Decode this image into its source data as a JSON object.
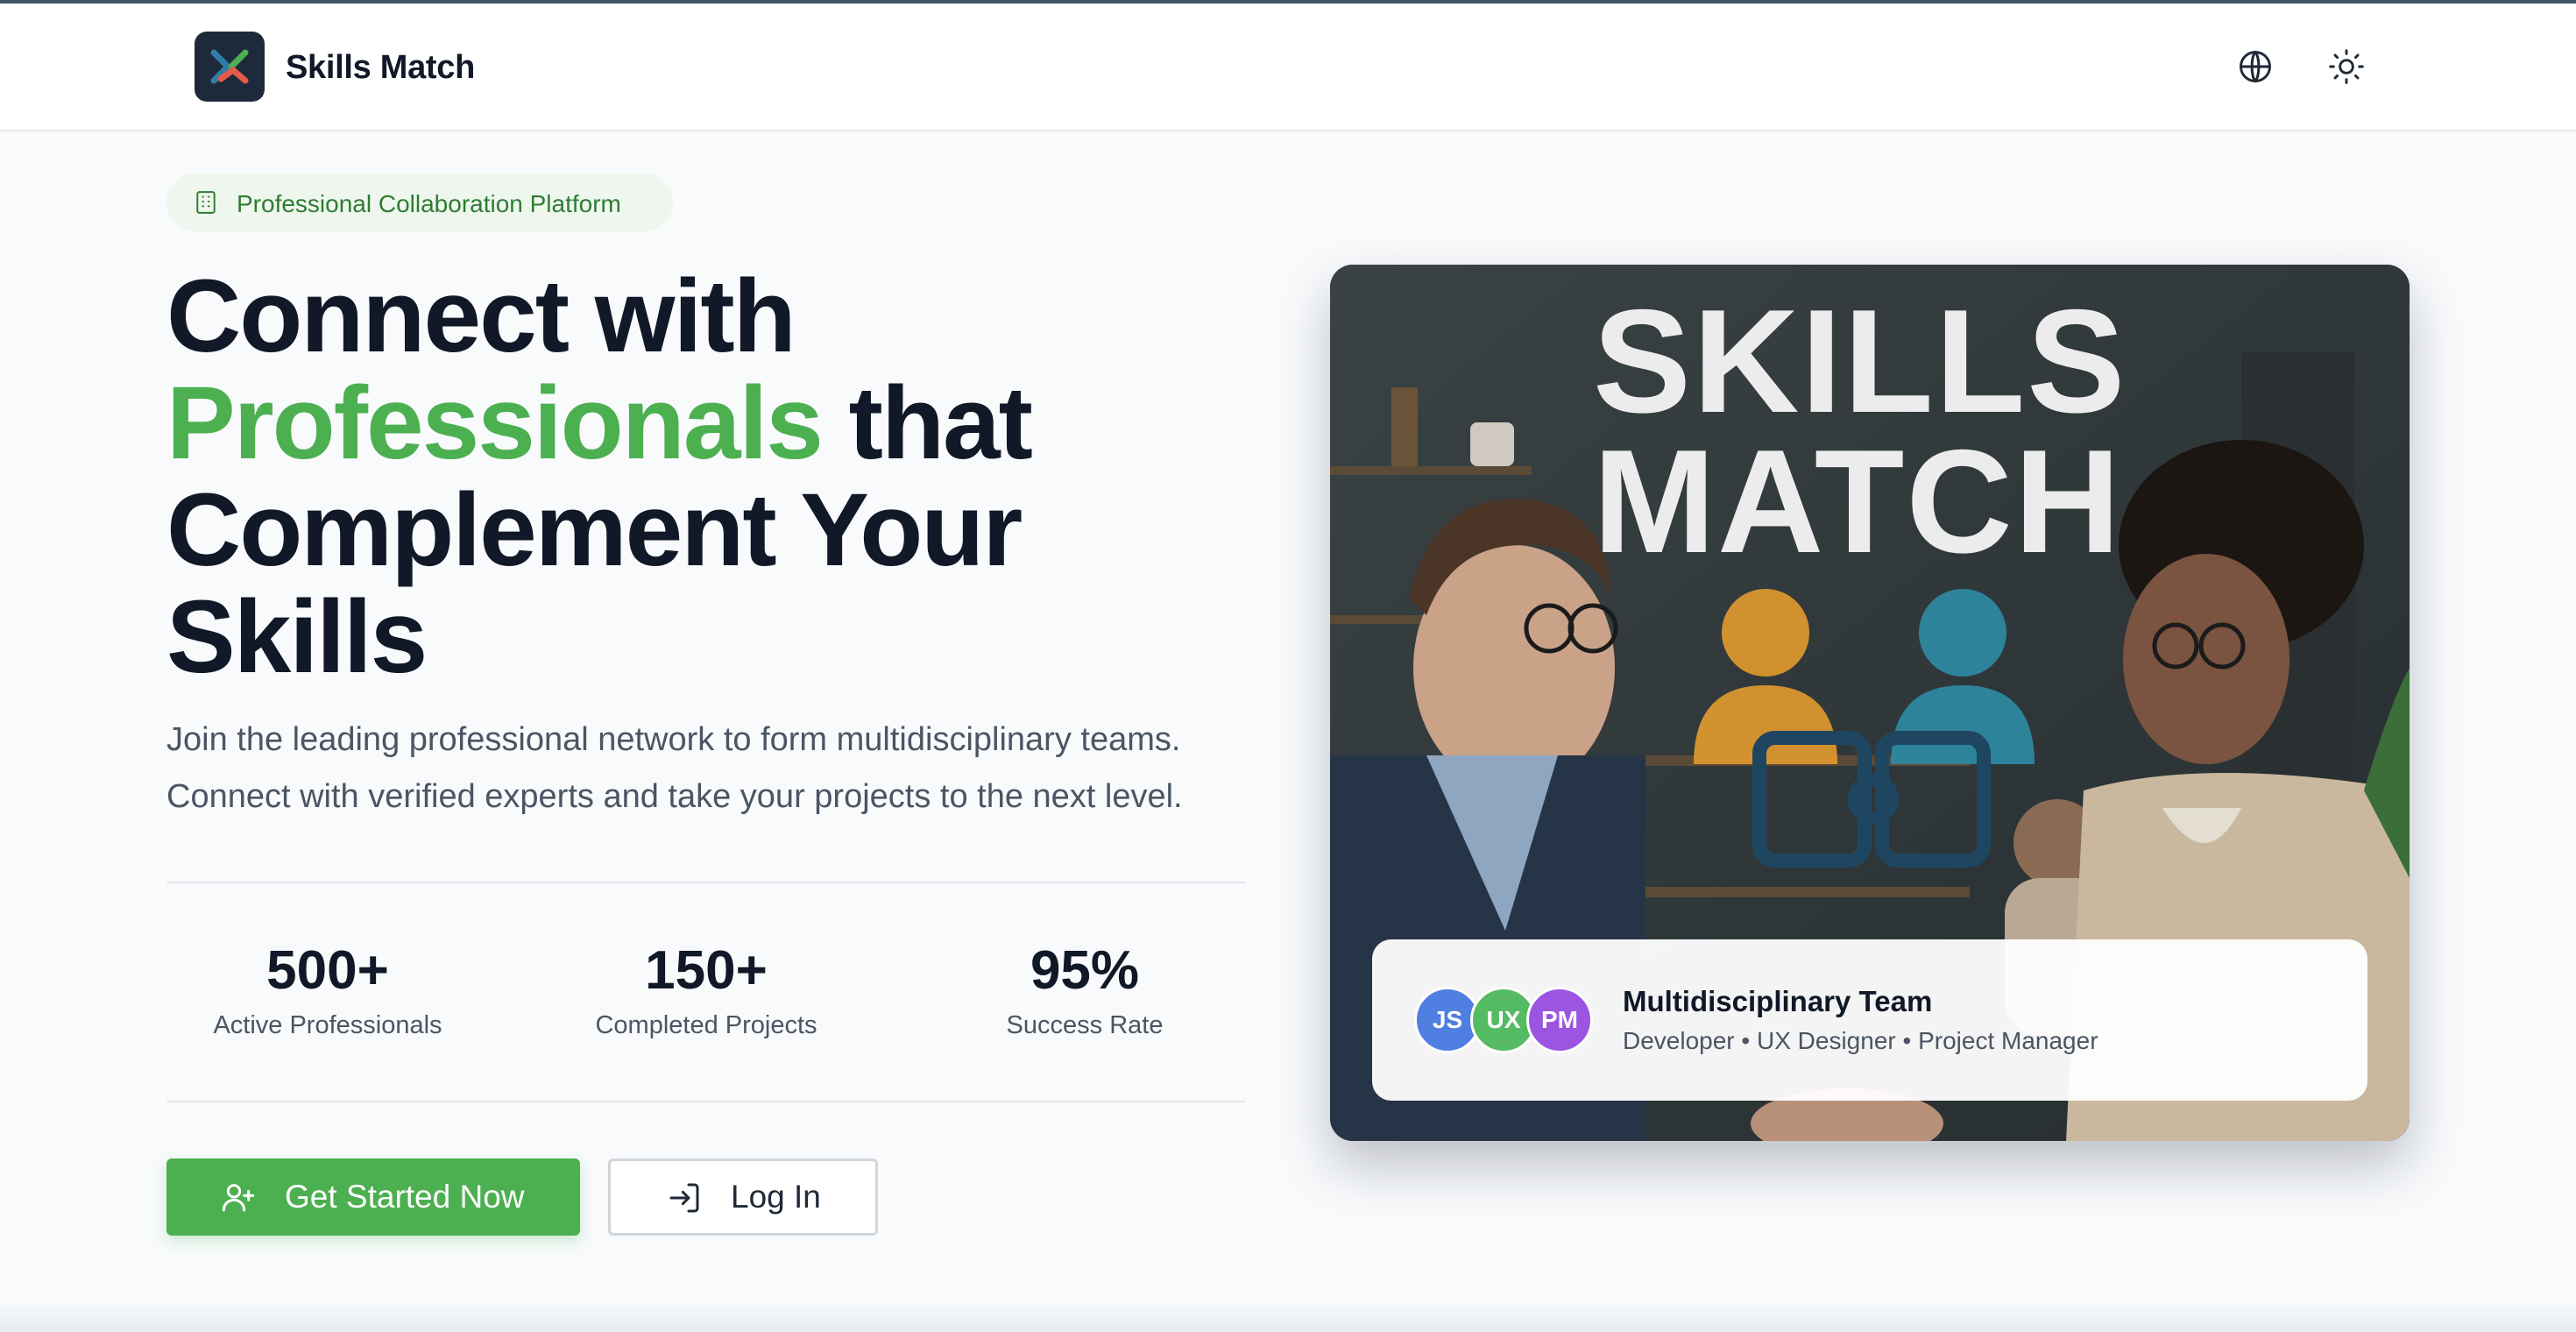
{
  "header": {
    "brand": "Skills Match",
    "icons": [
      "logo-icon",
      "globe-icon",
      "sun-icon"
    ]
  },
  "hero": {
    "badge": "Professional Collaboration Platform",
    "headline": {
      "line1": "Connect with",
      "line2_accent": "Professionals",
      "line2_rest": " that",
      "line3": "Complement Your",
      "line4": "Skills"
    },
    "subtitle_line1": "Join the leading professional network to form multidisciplinary teams.",
    "subtitle_line2": "Connect with verified experts and take your projects to the next level.",
    "stats": [
      {
        "value": "500+",
        "label": "Active Professionals"
      },
      {
        "value": "150+",
        "label": "Completed Projects"
      },
      {
        "value": "95%",
        "label": "Success Rate"
      }
    ],
    "primary_button": "Get Started Now",
    "secondary_button": "Log In"
  },
  "image_card": {
    "title_line1": "SKILLS",
    "title_line2": "MATCH",
    "team": {
      "avatars": [
        {
          "initials": "JS",
          "color": "#4f7fe0"
        },
        {
          "initials": "UX",
          "color": "#55bb62"
        },
        {
          "initials": "PM",
          "color": "#9b55e0"
        }
      ],
      "title": "Multidisciplinary Team",
      "roles": "Developer • UX Designer • Project Manager"
    }
  },
  "colors": {
    "accent": "#4caf50",
    "dark": "#111827",
    "badge_bg": "#eef6ee"
  }
}
